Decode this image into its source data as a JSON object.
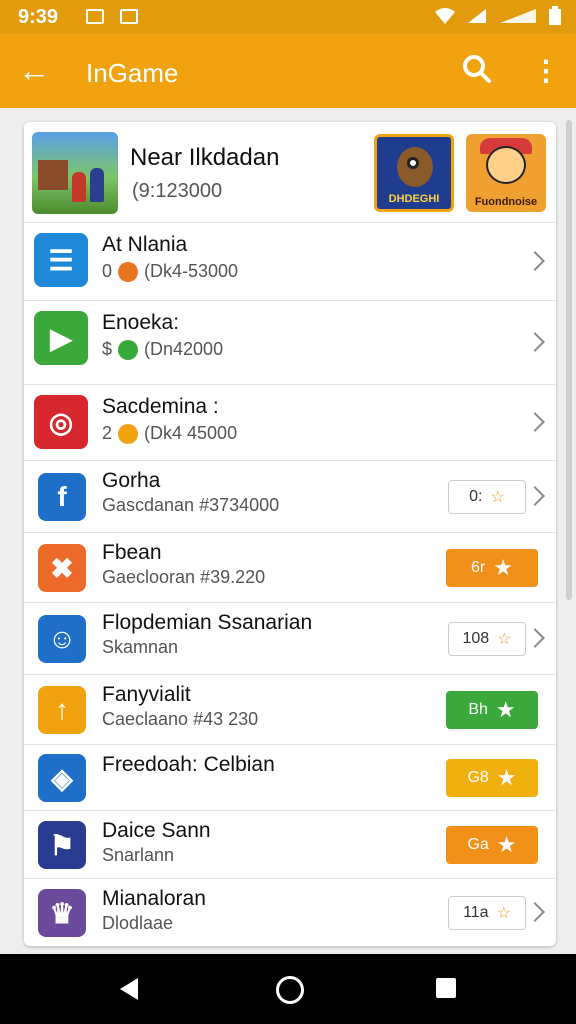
{
  "status_bar": {
    "time": "9:39"
  },
  "app_bar": {
    "title": "InGame",
    "back_icon": "back-arrow-icon",
    "search_icon": "search-icon",
    "more_icon": "more-vert-icon"
  },
  "featured": {
    "title": "Near Ilkdadan",
    "subtitle": "(9:123000",
    "tiles": [
      {
        "label": "DHDEGHI"
      },
      {
        "label": "Fuondnoise"
      }
    ]
  },
  "list": [
    {
      "title": "At Nlania",
      "sub_prefix": "0",
      "sub_value": "(Dk4-53000",
      "icon_color": "#1f88d8",
      "badge_color": "#e8741f",
      "action": "chevron"
    },
    {
      "title": "Enoeka:",
      "sub_prefix": "$",
      "sub_value": "(Dn42000",
      "icon_color": "#3aa83a",
      "badge_color": "#3aa83a",
      "action": "chevron"
    },
    {
      "title": "Sacdemina :",
      "sub_prefix": "2",
      "sub_value": "(Dk4 45000",
      "icon_color": "#d6262e",
      "badge_color": "#f0a20f",
      "action": "chevron"
    },
    {
      "title": "Gorha",
      "sub_value": "Gascdanan #3734000",
      "icon_color": "#1f6fc8",
      "action": "outline",
      "btn_label": "0:"
    },
    {
      "title": "Fbean",
      "sub_value": "Gaeclooran #39.220",
      "icon_color": "#ee6a2a",
      "action": "button",
      "btn_label": "6r",
      "btn_color": "#f09018"
    },
    {
      "title": "Flopdemian Ssanarian",
      "sub_value": "Skamnan",
      "icon_color": "#1f6fc8",
      "action": "outline",
      "btn_label": "108"
    },
    {
      "title": "Fanyvialit",
      "sub_value": "Caeclaano #43 230",
      "icon_color": "#f0a20f",
      "action": "button",
      "btn_label": "Bh",
      "btn_color": "#3aa83a"
    },
    {
      "title": "Freedoah: Celbian",
      "sub_value": "",
      "icon_color": "#1f6fc8",
      "action": "button",
      "btn_label": "G8",
      "btn_color": "#f0b010"
    },
    {
      "title": "Daice Sann",
      "sub_value": "Snarlann",
      "icon_color": "#2a3c8f",
      "action": "button",
      "btn_label": "Ga",
      "btn_color": "#f09018"
    },
    {
      "title": "Mianaloran",
      "sub_value": "Dlodlaae",
      "icon_color": "#6a4a9a",
      "action": "outline",
      "btn_label": "11a"
    }
  ]
}
